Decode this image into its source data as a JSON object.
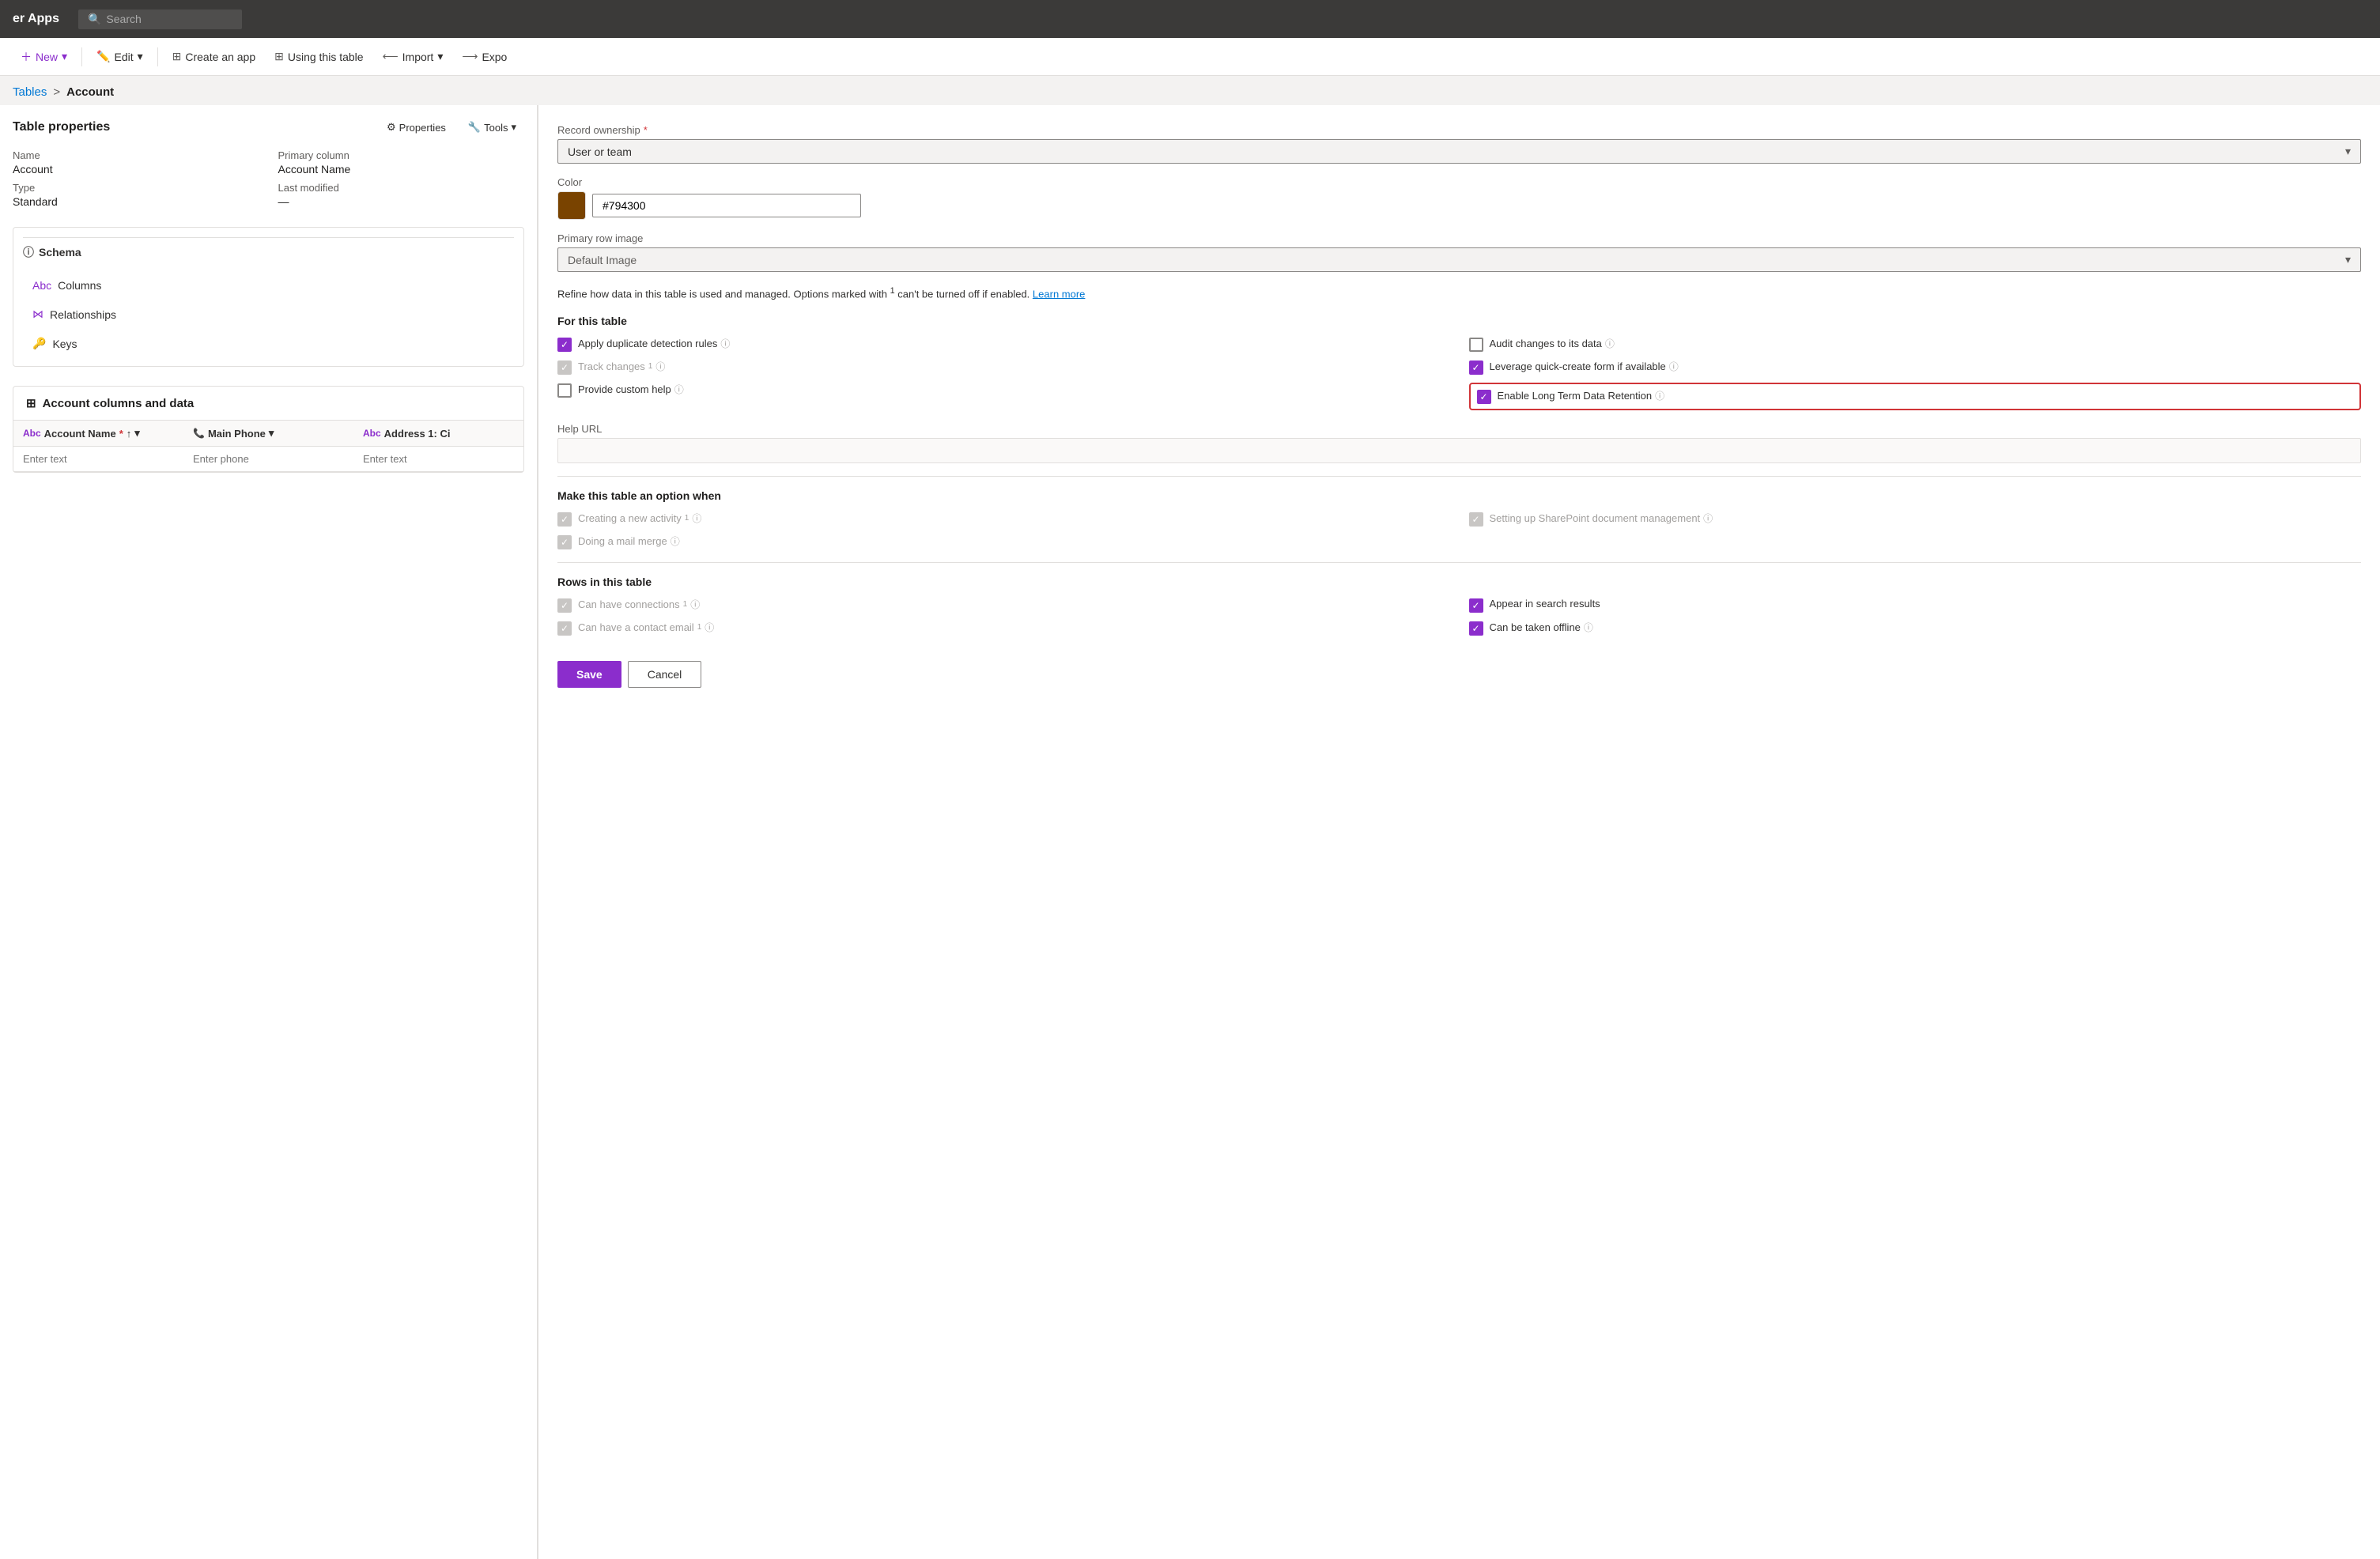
{
  "topbar": {
    "title": "er Apps",
    "search_placeholder": "Search"
  },
  "toolbar": {
    "new_label": "New",
    "edit_label": "Edit",
    "create_app_label": "Create an app",
    "using_table_label": "Using this table",
    "import_label": "Import",
    "export_label": "Expo"
  },
  "breadcrumb": {
    "parent": "Tables",
    "separator": ">",
    "current": "Account"
  },
  "left": {
    "table_properties_title": "Table properties",
    "properties_btn": "Properties",
    "tools_btn": "Tools",
    "name_label": "Name",
    "name_value": "Account",
    "primary_col_label": "Primary column",
    "primary_col_value": "Account Name",
    "type_label": "Type",
    "type_value": "Standard",
    "last_modified_label": "Last modified",
    "last_modified_value": "—",
    "schema_label": "Schema",
    "columns_item": "Columns",
    "relationships_item": "Relationships",
    "keys_item": "Keys",
    "account_columns_title": "Account columns and data",
    "col1_header": "Account Name",
    "col1_required": "*",
    "col2_header": "Main Phone",
    "col3_header": "Address 1: Ci",
    "col1_placeholder": "Enter text",
    "col2_placeholder": "Enter phone",
    "col3_placeholder": "Enter text"
  },
  "right": {
    "record_ownership_label": "Record ownership",
    "record_ownership_required": "*",
    "record_ownership_value": "User or team",
    "color_label": "Color",
    "color_swatch": "#794300",
    "color_value": "#794300",
    "primary_row_image_label": "Primary row image",
    "primary_row_image_value": "Default Image",
    "info_text_part1": "Refine how data in this table is used and managed. Options marked with",
    "info_text_sup": "1",
    "info_text_part2": "can't be turned off if enabled.",
    "learn_more": "Learn more",
    "for_this_table": "For this table",
    "apply_duplicate_label": "Apply duplicate detection rules",
    "audit_changes_label": "Audit changes to its data",
    "track_changes_label": "Track changes",
    "track_changes_sup": "1",
    "leverage_quick_label": "Leverage quick-create form if available",
    "provide_custom_help_label": "Provide custom help",
    "enable_ltdr_label": "Enable Long Term Data Retention",
    "help_url_label": "Help URL",
    "make_option_title": "Make this table an option when",
    "creating_activity_label": "Creating a new activity",
    "creating_activity_sup": "1",
    "sharepoint_label": "Setting up SharePoint document management",
    "mail_merge_label": "Doing a mail merge",
    "rows_title": "Rows in this table",
    "can_have_connections_label": "Can have connections",
    "can_have_connections_sup": "1",
    "appear_search_label": "Appear in search results",
    "can_have_contact_email_label": "Can have a contact email",
    "can_have_contact_email_sup": "1",
    "can_be_taken_offline_label": "Can be taken offline",
    "save_label": "Save",
    "cancel_label": "Cancel"
  }
}
